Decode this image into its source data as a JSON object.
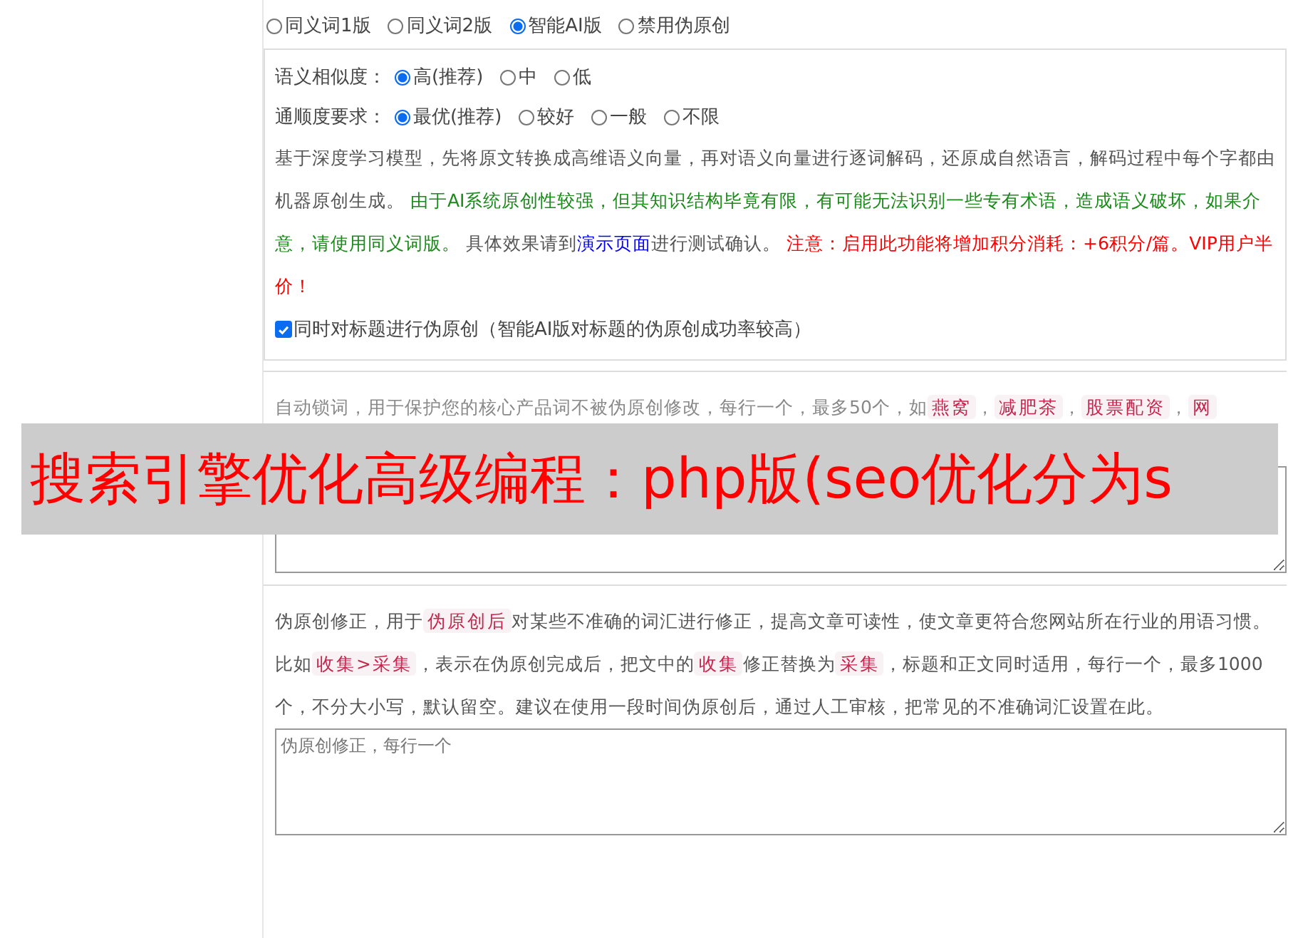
{
  "mode_options": [
    {
      "label": "同义词1版",
      "selected": false
    },
    {
      "label": "同义词2版",
      "selected": false
    },
    {
      "label": "智能AI版",
      "selected": true
    },
    {
      "label": "禁用伪原创",
      "selected": false
    }
  ],
  "ai_settings": {
    "similarity": {
      "label": "语义相似度：",
      "options": [
        {
          "label": "高(推荐)",
          "selected": true
        },
        {
          "label": "中",
          "selected": false
        },
        {
          "label": "低",
          "selected": false
        }
      ]
    },
    "fluency": {
      "label": "通顺度要求：",
      "options": [
        {
          "label": "最优(推荐)",
          "selected": true
        },
        {
          "label": "较好",
          "selected": false
        },
        {
          "label": "一般",
          "selected": false
        },
        {
          "label": "不限",
          "selected": false
        }
      ]
    },
    "description": [
      {
        "kind": "text",
        "text": "基于深度学习模型，先将原文转换成高维语义向量，再对语义向量进行逐词解码，还原成自然语言，解码过程中每个字都由机器原创生成。 "
      },
      {
        "kind": "success",
        "text": "由于AI系统原创性较强，但其知识结构毕竟有限，有可能无法识别一些专有术语，造成语义破坏，如果介意，请使用同义词版。"
      },
      {
        "kind": "text",
        "text": " 具体效果请到"
      },
      {
        "kind": "link",
        "text": "演示页面"
      },
      {
        "kind": "text",
        "text": "进行测试确认。 "
      },
      {
        "kind": "warning",
        "text": "注意：启用此功能将增加积分消耗：+6积分/篇。VIP用户半价！"
      }
    ],
    "title_option": {
      "label": "同时对标题进行伪原创（智能AI版对标题的伪原创成功率较高）",
      "checked": true
    }
  },
  "lock_words": {
    "description": [
      {
        "kind": "text",
        "text": "自动锁词，用于保护您的核心产品词不被伪原创修改，每行一个，最多50个，如"
      },
      {
        "kind": "code",
        "text": "燕窝"
      },
      {
        "kind": "text",
        "text": "，"
      },
      {
        "kind": "code",
        "text": "减肥茶"
      },
      {
        "kind": "text",
        "text": "，"
      },
      {
        "kind": "code",
        "text": "股票配资"
      },
      {
        "kind": "text",
        "text": "，"
      },
      {
        "kind": "code",
        "text": "网"
      }
    ]
  },
  "banner": {
    "text": "搜索引擎优化高级编程：php版(seo优化分为s"
  },
  "correction": {
    "description": [
      {
        "kind": "text",
        "text": "伪原创修正，用于"
      },
      {
        "kind": "code",
        "text": "伪原创后"
      },
      {
        "kind": "text",
        "text": "对某些不准确的词汇进行修正，提高文章可读性，使文章更符合您网站所在行业的用语习惯。比如"
      },
      {
        "kind": "code",
        "text": "收集>采集"
      },
      {
        "kind": "text",
        "text": "，表示在伪原创完成后，把文中的"
      },
      {
        "kind": "code",
        "text": "收集"
      },
      {
        "kind": "text",
        "text": "修正替换为"
      },
      {
        "kind": "code",
        "text": "采集"
      },
      {
        "kind": "text",
        "text": "，标题和正文同时适用，每行一个，最多1000个，不分大小写，默认留空。建议在使用一段时间伪原创后，通过人工审核，把常见的不准确词汇设置在此。"
      }
    ],
    "placeholder": "伪原创修正，每行一个"
  }
}
